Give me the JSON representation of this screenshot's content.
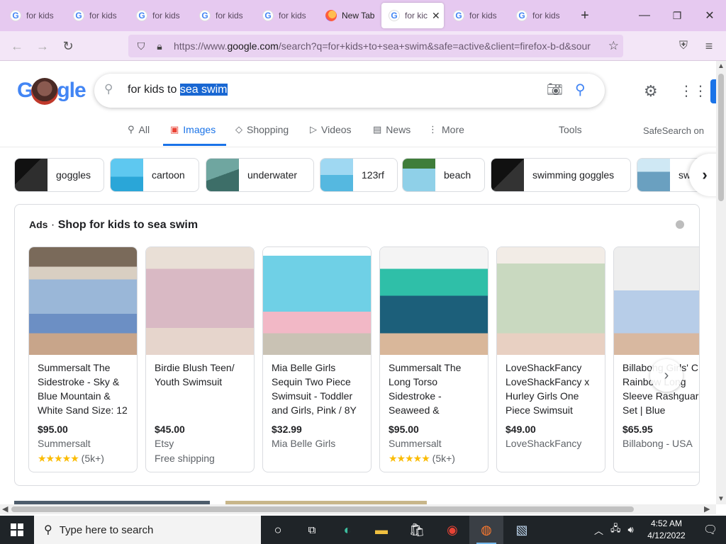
{
  "browser": {
    "tabs": [
      {
        "label": "for kids t",
        "icon": "google-icon",
        "active": false
      },
      {
        "label": "for kids t",
        "icon": "google-icon",
        "active": false
      },
      {
        "label": "for kids t",
        "icon": "google-icon",
        "active": false
      },
      {
        "label": "for kids t",
        "icon": "google-icon",
        "active": false
      },
      {
        "label": "for kids t",
        "icon": "google-icon",
        "active": false
      },
      {
        "label": "New Tab",
        "icon": "firefox-icon",
        "active": false
      },
      {
        "label": "for kic",
        "icon": "google-icon",
        "active": true
      },
      {
        "label": "for kids t",
        "icon": "google-icon",
        "active": false
      },
      {
        "label": "for kids t",
        "icon": "google-icon",
        "active": false
      }
    ],
    "url_prefix": "https://www.",
    "url_domain": "google.com",
    "url_rest": "/search?q=for+kids+to+sea+swim&safe=active&client=firefox-b-d&sour"
  },
  "google": {
    "logo_text_left": "G",
    "logo_text_right": "gle",
    "query_plain": "for kids to ",
    "query_selected": "sea swim",
    "tabs": [
      "All",
      "Images",
      "Shopping",
      "Videos",
      "News",
      "More"
    ],
    "tools": "Tools",
    "safesearch": "SafeSearch on"
  },
  "chips": [
    "goggles",
    "cartoon",
    "underwater",
    "123rf",
    "beach",
    "swimming goggles",
    "sw"
  ],
  "ads": {
    "label": "Ads",
    "separator": "·",
    "title": "Shop for kids to sea swim",
    "products": [
      {
        "title": "Summersalt The Sidestroke - Sky & Blue Mountain & White Sand Size: 12",
        "price": "$95.00",
        "store": "Summersalt",
        "stars": "★★★★★",
        "extra": "(5k+)"
      },
      {
        "title": "Birdie Blush Teen/ Youth Swimsuit",
        "price": "$45.00",
        "store": "Etsy",
        "stars": "",
        "extra": "Free shipping"
      },
      {
        "title": "Mia Belle Girls Sequin Two Piece Swimsuit - Toddler and Girls, Pink / 8Y",
        "price": "$32.99",
        "store": "Mia Belle Girls",
        "stars": "",
        "extra": ""
      },
      {
        "title": "Summersalt The Long Torso Sidestroke - Seaweed &",
        "price": "$95.00",
        "store": "Summersalt",
        "stars": "★★★★★",
        "extra": "(5k+)"
      },
      {
        "title": "LoveShackFancy LoveShackFancy x Hurley Girls One Piece Swimsuit",
        "price": "$49.00",
        "store": "LoveShackFancy",
        "stars": "",
        "extra": ""
      },
      {
        "title": "Billabong Girls' C A Rainbow Long Sleeve Rashguard Set | Blue",
        "price": "$65.95",
        "store": "Billabong - USA",
        "stars": "",
        "extra": ""
      }
    ]
  },
  "taskbar": {
    "search_placeholder": "Type here to search",
    "time": "4:52 AM",
    "date": "4/12/2022"
  },
  "colors": {
    "tabstrip": "#e6c9f0",
    "accent": "#1a73e8",
    "taskbar": "#1f2428"
  }
}
